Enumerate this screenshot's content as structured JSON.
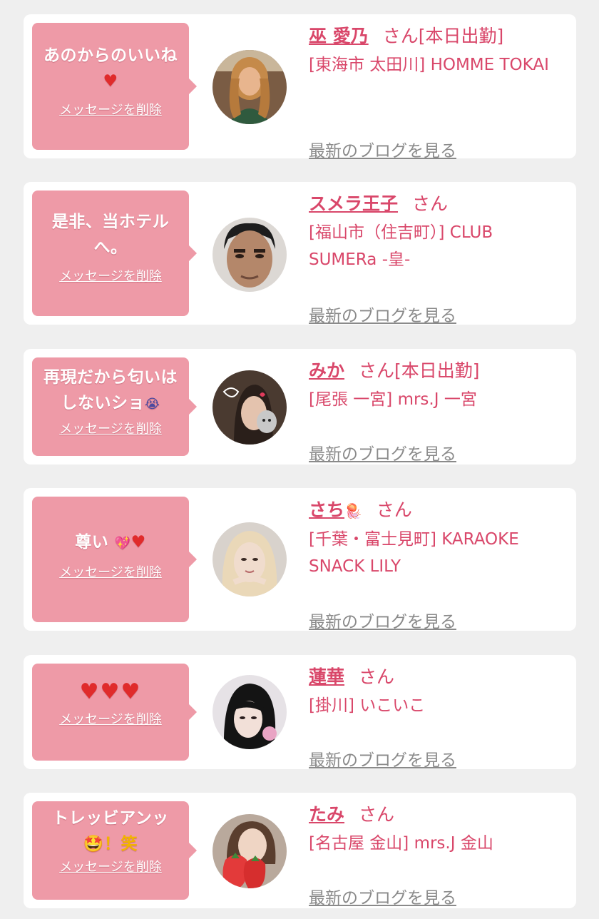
{
  "colors": {
    "background": "#efefef",
    "card": "#ffffff",
    "bubble": "#ee9aa7",
    "accent_text": "#d9476a",
    "link_gray": "#8a8a8a"
  },
  "delete_label": "メッセージを削除",
  "blog_label": "最新のブログを見る",
  "san_suffix": "さん",
  "messages": [
    {
      "message": "あのからのいいね",
      "message_emoji": "♥",
      "name": "巫 愛乃",
      "status": "[本日出勤]",
      "shop": "[東海市 太田川] HOMME TOKAI",
      "avatar_icon": "woman-portrait-photo"
    },
    {
      "message": "是非、当ホテルへ。",
      "message_emoji": "",
      "name": "スメラ王子",
      "status": "",
      "shop": "[福山市（住吉町）] CLUB SUMERa -皇-",
      "avatar_icon": "man-portrait-photo"
    },
    {
      "message": "再現だから匂いはしないショ",
      "message_emoji": "😭",
      "name": "みか",
      "status": "[本日出勤]",
      "shop": "[尾張 一宮] mrs.J 一宮",
      "avatar_icon": "woman-with-cat-photo"
    },
    {
      "message": "尊い",
      "message_emoji": "💖♥",
      "name": "さち",
      "name_emoji": "🪼",
      "status": "",
      "shop": "[千葉・富士見町] KARAOKE SNACK LILY",
      "avatar_icon": "woman-blonde-photo"
    },
    {
      "message": "",
      "message_emoji": "♥♥♥",
      "name": "蓮華",
      "status": "",
      "shop": "[掛川] いこいこ",
      "avatar_icon": "woman-black-hair-photo"
    },
    {
      "message": "トレッビアンッ",
      "message_suffix": "🤩！笑",
      "name": "たみ",
      "status": "",
      "shop": "[名古屋 金山] mrs.J 金山",
      "avatar_icon": "woman-with-strawberry-photo"
    }
  ]
}
